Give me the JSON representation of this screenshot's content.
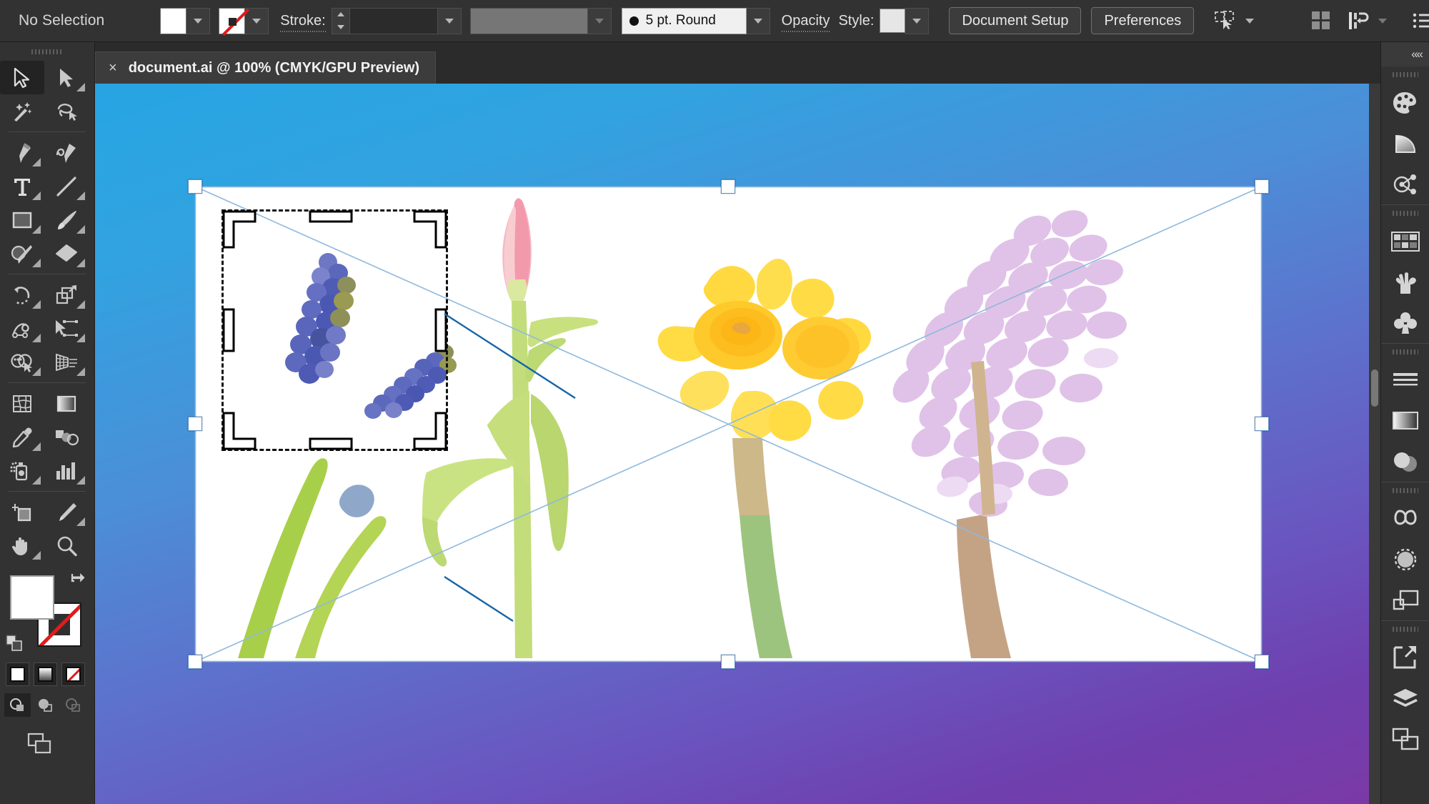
{
  "app": {
    "name": "Adobe Illustrator"
  },
  "control_bar": {
    "selection_status": "No Selection",
    "fill_swatch_label": "white-fill-swatch",
    "stroke_swatch_label": "none-stroke-swatch",
    "stroke_label": "Stroke:",
    "stroke_weight_value": "",
    "stroke_profile_value": "",
    "brush_definition_value": "5 pt. Round",
    "opacity_label": "Opacity",
    "style_label": "Style:",
    "document_setup_label": "Document Setup",
    "preferences_label": "Preferences",
    "select_similar_icon": "select-similar-objects-icon",
    "arrange_icon": "arrange-documents-icon",
    "align_icon": "align-icon",
    "menu_icon": "hamburger-menu-icon"
  },
  "tab": {
    "close_glyph": "×",
    "title": "document.ai @ 100% (CMYK/GPU Preview)"
  },
  "left_toolbar": {
    "tools": [
      {
        "name": "selection-tool",
        "active": true,
        "has_flyout": false
      },
      {
        "name": "direct-selection-tool",
        "active": false,
        "has_flyout": true
      },
      {
        "name": "magic-wand-tool",
        "active": false,
        "has_flyout": false
      },
      {
        "name": "lasso-tool",
        "active": false,
        "has_flyout": false
      },
      {
        "name": "pen-tool",
        "active": false,
        "has_flyout": true
      },
      {
        "name": "curvature-tool",
        "active": false,
        "has_flyout": false
      },
      {
        "name": "type-tool",
        "active": false,
        "has_flyout": true
      },
      {
        "name": "line-segment-tool",
        "active": false,
        "has_flyout": true
      },
      {
        "name": "rectangle-tool",
        "active": false,
        "has_flyout": true
      },
      {
        "name": "paintbrush-tool",
        "active": false,
        "has_flyout": true
      },
      {
        "name": "shaper-tool",
        "active": false,
        "has_flyout": true
      },
      {
        "name": "eraser-tool",
        "active": false,
        "has_flyout": true
      },
      {
        "name": "rotate-tool",
        "active": false,
        "has_flyout": true
      },
      {
        "name": "scale-tool",
        "active": false,
        "has_flyout": true
      },
      {
        "name": "width-tool",
        "active": false,
        "has_flyout": true
      },
      {
        "name": "free-transform-tool",
        "active": false,
        "has_flyout": true
      },
      {
        "name": "shape-builder-tool",
        "active": false,
        "has_flyout": true
      },
      {
        "name": "perspective-grid-tool",
        "active": false,
        "has_flyout": true
      },
      {
        "name": "mesh-tool",
        "active": false,
        "has_flyout": false
      },
      {
        "name": "gradient-tool",
        "active": false,
        "has_flyout": false
      },
      {
        "name": "eyedropper-tool",
        "active": false,
        "has_flyout": true
      },
      {
        "name": "blend-tool",
        "active": false,
        "has_flyout": false
      },
      {
        "name": "symbol-sprayer-tool",
        "active": false,
        "has_flyout": true
      },
      {
        "name": "column-graph-tool",
        "active": false,
        "has_flyout": true
      },
      {
        "name": "artboard-tool",
        "active": false,
        "has_flyout": false
      },
      {
        "name": "slice-tool",
        "active": false,
        "has_flyout": true
      },
      {
        "name": "hand-tool",
        "active": false,
        "has_flyout": true
      },
      {
        "name": "zoom-tool",
        "active": false,
        "has_flyout": false
      }
    ],
    "fill_color": "#ffffff",
    "stroke_color": "none",
    "paint_modes": [
      "color-fill",
      "gradient-fill",
      "none-fill"
    ],
    "draw_modes": [
      "draw-normal",
      "draw-behind",
      "draw-inside"
    ],
    "screen_mode": "change-screen-mode"
  },
  "right_dock": {
    "groups": [
      [
        "color-panel-icon",
        "color-guide-panel-icon",
        "adobe-color-themes-panel-icon"
      ],
      [
        "swatches-panel-icon",
        "brushes-panel-icon",
        "symbols-panel-icon"
      ],
      [
        "stroke-panel-icon",
        "gradient-panel-icon",
        "transparency-panel-icon"
      ],
      [
        "creative-cloud-libraries-panel-icon",
        "appearance-panel-icon",
        "graphic-styles-panel-icon"
      ],
      [
        "export-panel-icon",
        "layers-panel-icon",
        "artboards-panel-icon"
      ]
    ],
    "collapse_glyph": "««"
  },
  "canvas": {
    "background_gradient_from": "#27a4e3",
    "background_gradient_to": "#7a3aa6",
    "artboard_fill": "#ffffff",
    "selection_stroke": "#5f93c9",
    "crop_frame_stroke": "#111111",
    "crop_frame_blue_edge": "#1565a8",
    "zoom_level": "100%",
    "color_mode": "CMYK",
    "preview_mode": "GPU Preview",
    "artwork": [
      {
        "name": "grape-hyacinth-flower",
        "color": "#4a5fc0"
      },
      {
        "name": "tulip-flower",
        "color": "#f4a6b0"
      },
      {
        "name": "daffodil-flower",
        "color": "#ffd83d"
      },
      {
        "name": "hyacinth-flower",
        "color": "#d9b8e0"
      }
    ]
  }
}
